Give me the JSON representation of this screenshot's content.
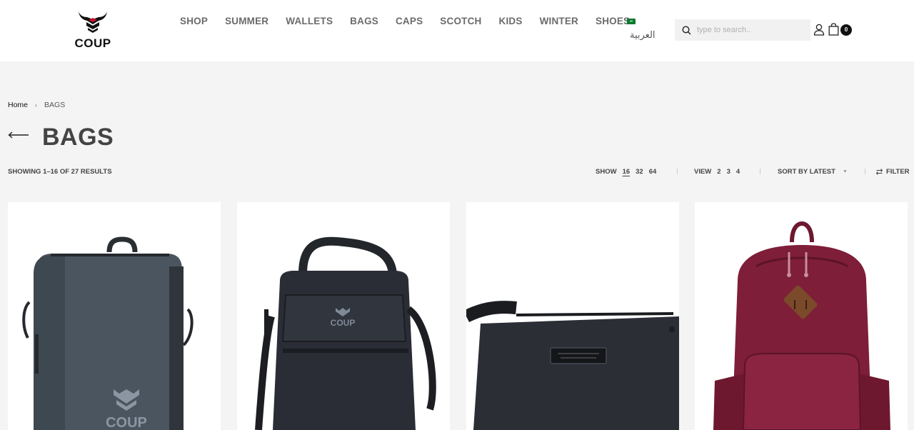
{
  "header": {
    "logo_text": "COUP",
    "nav": [
      "SHOP",
      "SUMMER",
      "WALLETS",
      "BAGS",
      "CAPS",
      "SCOTCH",
      "KIDS",
      "WINTER",
      "SHOES"
    ],
    "language": "العربية",
    "search_placeholder": "type to search..",
    "cart_count": "0",
    "colors": {
      "nav_text": "#6b6b6b",
      "header_bg": "#ffffff",
      "page_bg": "#f4f4f4"
    }
  },
  "breadcrumb": {
    "home": "Home",
    "separator": "›",
    "current": "BAGS"
  },
  "page": {
    "title": "BAGS"
  },
  "toolbar": {
    "results": "SHOWING 1–16 OF 27 RESULTS",
    "show_label": "SHOW",
    "show_options": [
      "16",
      "32",
      "64"
    ],
    "show_selected": "16",
    "view_label": "VIEW",
    "view_options": [
      "2",
      "3",
      "4"
    ],
    "sort_label": "SORT BY LATEST",
    "filter_label": "FILTER"
  },
  "products": [
    {
      "name": "grey-crossbody-bag",
      "logo_text": "COUP",
      "color": "#4a5560"
    },
    {
      "name": "black-messenger-bag",
      "logo_text": "COUP",
      "color": "#2a2d35"
    },
    {
      "name": "black-laptop-bag",
      "color": "#2c2e36"
    },
    {
      "name": "maroon-backpack",
      "color": "#7e1e38"
    }
  ]
}
